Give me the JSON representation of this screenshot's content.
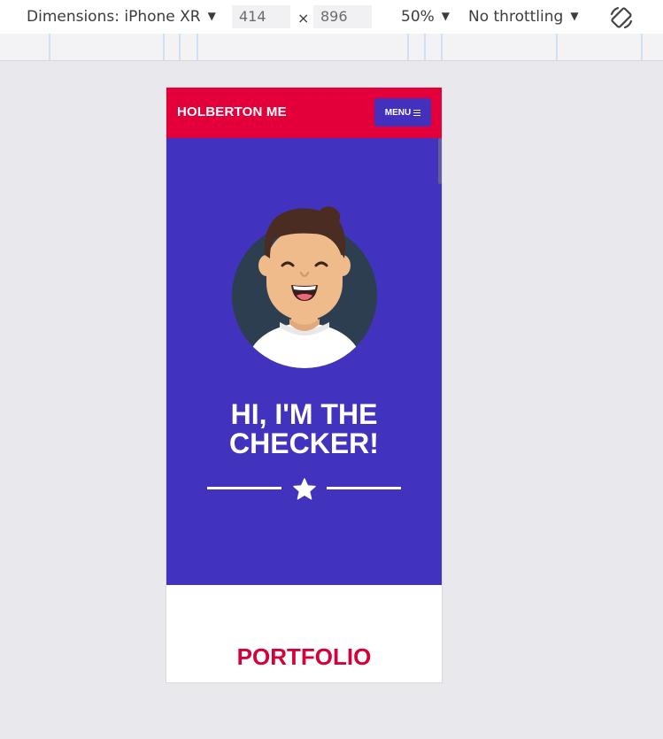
{
  "devtools": {
    "device_label": "Dimensions: iPhone XR",
    "width_value": "414",
    "times_symbol": "×",
    "height_value": "896",
    "zoom_label": "50%",
    "throttling_label": "No throttling",
    "icons": [
      "chevron-down-icon",
      "rotate-icon"
    ]
  },
  "site": {
    "brand": "HOLBERTON ME",
    "menu_label": "MENU",
    "hero_title": "HI, I'M THE CHECKER!",
    "section_title": "PORTFOLIO"
  },
  "colors": {
    "header_bg": "#e3003a",
    "hero_bg": "#4233be",
    "menu_button_bg": "#4331be",
    "portfolio_title": "#d6003a"
  }
}
